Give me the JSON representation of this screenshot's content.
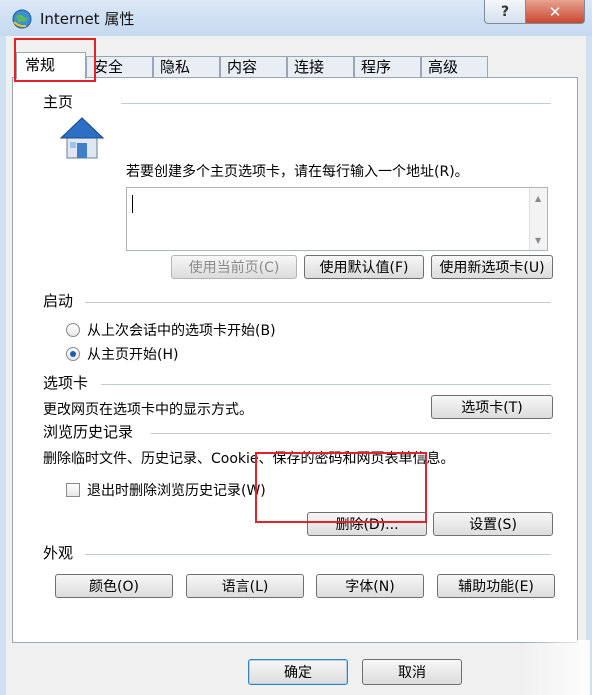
{
  "window": {
    "title": "Internet 属性",
    "help_label": "?",
    "close_label": "✕",
    "icon": "globe-icon"
  },
  "tabs": [
    {
      "label": "常规",
      "active": true
    },
    {
      "label": "安全"
    },
    {
      "label": "隐私"
    },
    {
      "label": "内容"
    },
    {
      "label": "连接"
    },
    {
      "label": "程序"
    },
    {
      "label": "高级"
    }
  ],
  "home": {
    "title": "主页",
    "description": "若要创建多个主页选项卡，请在每行输入一个地址(R)。",
    "address_value": "",
    "use_current_label": "使用当前页(C)",
    "use_default_label": "使用默认值(F)",
    "use_new_tab_label": "使用新选项卡(U)",
    "icon": "house-icon"
  },
  "startup": {
    "title": "启动",
    "option_last_session": "从上次会话中的选项卡开始(B)",
    "option_home": "从主页开始(H)",
    "selected": "home"
  },
  "tabs_section": {
    "title": "选项卡",
    "description": "更改网页在选项卡中的显示方式。",
    "button_label": "选项卡(T)"
  },
  "history": {
    "title": "浏览历史记录",
    "description": "删除临时文件、历史记录、Cookie、保存的密码和网页表单信息。",
    "delete_on_exit_label": "退出时删除浏览历史记录(W)",
    "delete_on_exit_checked": false,
    "delete_label": "删除(D)...",
    "settings_label": "设置(S)"
  },
  "appearance": {
    "title": "外观",
    "colors_label": "颜色(O)",
    "languages_label": "语言(L)",
    "fonts_label": "字体(N)",
    "accessibility_label": "辅助功能(E)"
  },
  "footer": {
    "ok_label": "确定",
    "cancel_label": "取消"
  },
  "colors": {
    "highlight": "#e0242b",
    "selection": "#1c5cb8"
  }
}
